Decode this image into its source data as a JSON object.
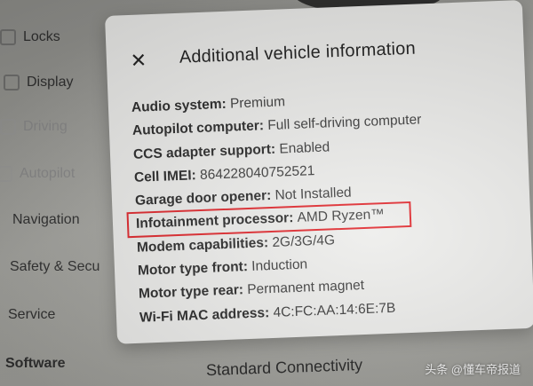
{
  "sidebar": {
    "items": [
      {
        "label": "Locks",
        "icon": "lock-icon"
      },
      {
        "label": "Display",
        "icon": "display-icon"
      },
      {
        "label": "Driving",
        "icon": "car-icon"
      },
      {
        "label": "Autopilot",
        "icon": "steering-wheel-icon"
      },
      {
        "label": "Navigation",
        "icon": null
      },
      {
        "label": "Safety & Secu",
        "icon": null
      },
      {
        "label": "Service",
        "icon": null
      },
      {
        "label": "Software",
        "icon": null
      }
    ]
  },
  "modal": {
    "close_icon": "✕",
    "title": "Additional vehicle information",
    "rows": [
      {
        "label": "Audio system:",
        "value": "Premium"
      },
      {
        "label": "Autopilot computer:",
        "value": "Full self-driving computer"
      },
      {
        "label": "CCS adapter support:",
        "value": "Enabled"
      },
      {
        "label": "Cell IMEI:",
        "value": "864228040752521"
      },
      {
        "label": "Garage door opener:",
        "value": "Not Installed"
      },
      {
        "label": "Infotainment processor:",
        "value": "AMD Ryzen™",
        "highlighted": true
      },
      {
        "label": "Modem capabilities:",
        "value": "2G/3G/4G"
      },
      {
        "label": "Motor type front:",
        "value": "Induction"
      },
      {
        "label": "Motor type rear:",
        "value": "Permanent magnet"
      },
      {
        "label": "Wi-Fi MAC address:",
        "value": "4C:FC:AA:14:6E:7B"
      }
    ]
  },
  "bottom": {
    "text": "Standard Connectivity"
  },
  "watermark": {
    "text": "头条 @懂车帝报道"
  },
  "colors": {
    "highlight_border": "#e0262b",
    "modal_background": "#ededeb"
  }
}
